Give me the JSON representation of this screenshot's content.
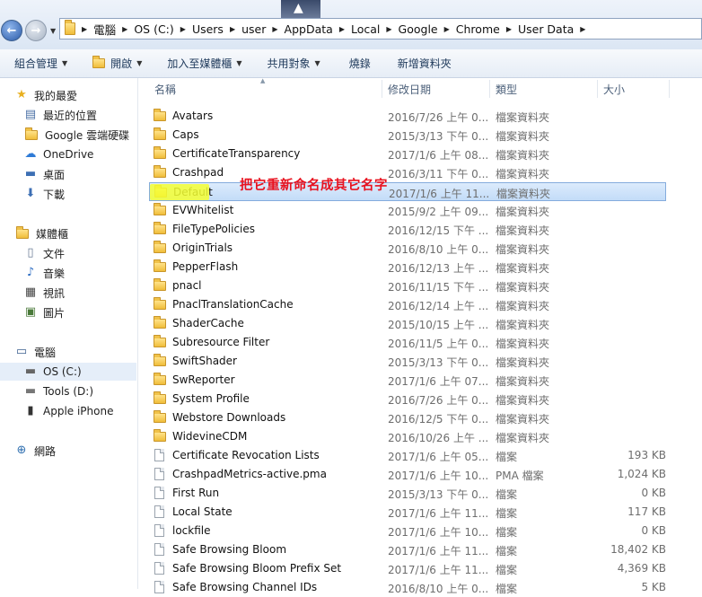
{
  "address": {
    "crumbs": [
      "電腦",
      "OS (C:)",
      "Users",
      "user",
      "AppData",
      "Local",
      "Google",
      "Chrome",
      "User Data"
    ]
  },
  "toolbar": {
    "organize": "組合管理",
    "open": "開啟",
    "include_library": "加入至媒體櫃",
    "share": "共用對象",
    "burn": "燒錄",
    "new_folder": "新增資料夾"
  },
  "nav": {
    "favorites": "我的最愛",
    "fav_items": [
      "最近的位置",
      "Google 雲端硬碟",
      "OneDrive",
      "桌面",
      "下載"
    ],
    "libraries": "媒體櫃",
    "lib_items": [
      "文件",
      "音樂",
      "視訊",
      "圖片"
    ],
    "computer": "電腦",
    "computer_items": [
      "OS (C:)",
      "Tools (D:)",
      "Apple iPhone"
    ],
    "network": "網路"
  },
  "columns": {
    "name": "名稱",
    "date": "修改日期",
    "type": "類型",
    "size": "大小"
  },
  "files": [
    {
      "name": "Avatars",
      "date": "2016/7/26 上午 0...",
      "type": "檔案資料夾",
      "size": "",
      "folder": true
    },
    {
      "name": "Caps",
      "date": "2015/3/13 下午 0...",
      "type": "檔案資料夾",
      "size": "",
      "folder": true
    },
    {
      "name": "CertificateTransparency",
      "date": "2017/1/6 上午 08...",
      "type": "檔案資料夾",
      "size": "",
      "folder": true
    },
    {
      "name": "Crashpad",
      "date": "2016/3/11 下午 0...",
      "type": "檔案資料夾",
      "size": "",
      "folder": true
    },
    {
      "name": "Default",
      "date": "2017/1/6 上午 11...",
      "type": "檔案資料夾",
      "size": "",
      "folder": true
    },
    {
      "name": "EVWhitelist",
      "date": "2015/9/2 上午 09...",
      "type": "檔案資料夾",
      "size": "",
      "folder": true
    },
    {
      "name": "FileTypePolicies",
      "date": "2016/12/15 下午 ...",
      "type": "檔案資料夾",
      "size": "",
      "folder": true
    },
    {
      "name": "OriginTrials",
      "date": "2016/8/10 上午 0...",
      "type": "檔案資料夾",
      "size": "",
      "folder": true
    },
    {
      "name": "PepperFlash",
      "date": "2016/12/13 上午 ...",
      "type": "檔案資料夾",
      "size": "",
      "folder": true
    },
    {
      "name": "pnacl",
      "date": "2016/11/15 下午 ...",
      "type": "檔案資料夾",
      "size": "",
      "folder": true
    },
    {
      "name": "PnaclTranslationCache",
      "date": "2016/12/14 上午 ...",
      "type": "檔案資料夾",
      "size": "",
      "folder": true
    },
    {
      "name": "ShaderCache",
      "date": "2015/10/15 上午 ...",
      "type": "檔案資料夾",
      "size": "",
      "folder": true
    },
    {
      "name": "Subresource Filter",
      "date": "2016/11/5 上午 0...",
      "type": "檔案資料夾",
      "size": "",
      "folder": true
    },
    {
      "name": "SwiftShader",
      "date": "2015/3/13 下午 0...",
      "type": "檔案資料夾",
      "size": "",
      "folder": true
    },
    {
      "name": "SwReporter",
      "date": "2017/1/6 上午 07...",
      "type": "檔案資料夾",
      "size": "",
      "folder": true
    },
    {
      "name": "System Profile",
      "date": "2016/7/26 上午 0...",
      "type": "檔案資料夾",
      "size": "",
      "folder": true
    },
    {
      "name": "Webstore Downloads",
      "date": "2016/12/5 下午 0...",
      "type": "檔案資料夾",
      "size": "",
      "folder": true
    },
    {
      "name": "WidevineCDM",
      "date": "2016/10/26 上午 ...",
      "type": "檔案資料夾",
      "size": "",
      "folder": true
    },
    {
      "name": "Certificate Revocation Lists",
      "date": "2017/1/6 上午 05...",
      "type": "檔案",
      "size": "193 KB",
      "folder": false
    },
    {
      "name": "CrashpadMetrics-active.pma",
      "date": "2017/1/6 上午 10...",
      "type": "PMA 檔案",
      "size": "1,024 KB",
      "folder": false
    },
    {
      "name": "First Run",
      "date": "2015/3/13 下午 0...",
      "type": "檔案",
      "size": "0 KB",
      "folder": false
    },
    {
      "name": "Local State",
      "date": "2017/1/6 上午 11...",
      "type": "檔案",
      "size": "117 KB",
      "folder": false
    },
    {
      "name": "lockfile",
      "date": "2017/1/6 上午 10...",
      "type": "檔案",
      "size": "0 KB",
      "folder": false
    },
    {
      "name": "Safe Browsing Bloom",
      "date": "2017/1/6 上午 11...",
      "type": "檔案",
      "size": "18,402 KB",
      "folder": false
    },
    {
      "name": "Safe Browsing Bloom Prefix Set",
      "date": "2017/1/6 上午 11...",
      "type": "檔案",
      "size": "4,369 KB",
      "folder": false
    },
    {
      "name": "Safe Browsing Channel IDs",
      "date": "2016/8/10 上午 0...",
      "type": "檔案",
      "size": "5 KB",
      "folder": false
    }
  ],
  "selected_index": 4,
  "annotation": "把它重新命名成其它名字"
}
